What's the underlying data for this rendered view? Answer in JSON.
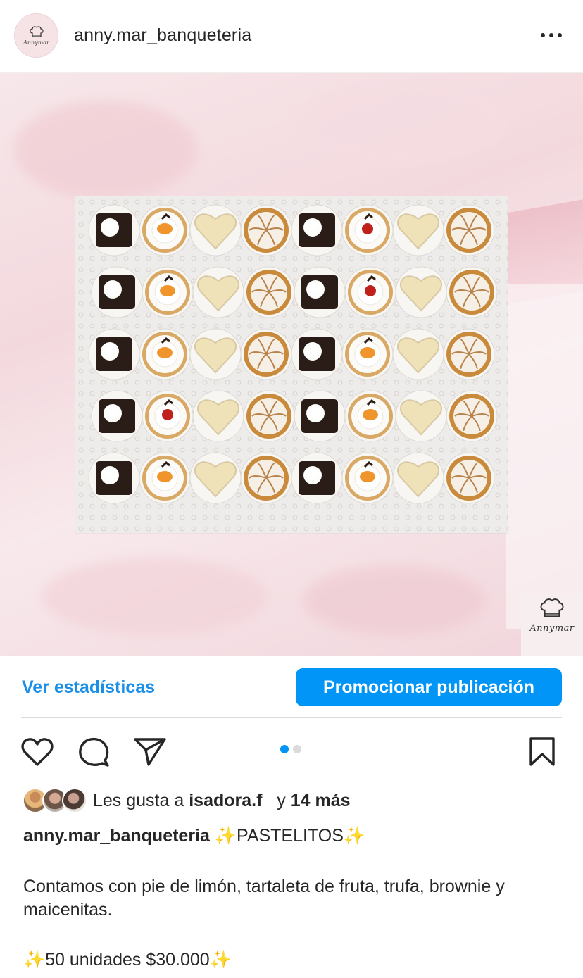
{
  "header": {
    "username": "anny.mar_banqueteria",
    "avatar_icon": "chef-hat-icon",
    "more_icon": "more-options-icon"
  },
  "post": {
    "watermark_icon": "chef-hat-icon",
    "slide_count": 2,
    "active_slide": 1
  },
  "actions": {
    "insights_label": "Ver estadísticas",
    "promote_label": "Promocionar publicación",
    "like_icon": "heart-icon",
    "comment_icon": "comment-icon",
    "share_icon": "paper-plane-icon",
    "save_icon": "bookmark-icon"
  },
  "likes": {
    "prefix": "Les gusta a ",
    "user": "isadora.f_",
    "connector": " y ",
    "others": "14 más"
  },
  "caption": {
    "username": "anny.mar_banqueteria",
    "title_spark_left": "✨",
    "title": "PASTELITOS",
    "title_spark_right": "✨",
    "body": "Contamos con pie de limón, tartaleta de fruta, trufa, brownie y maicenitas.",
    "offer_spark_left": "✨",
    "offer": "50 unidades $30.000",
    "offer_spark_right": "✨"
  },
  "colors": {
    "accent": "#0095f6",
    "link": "#1a8fe8",
    "text": "#262626"
  }
}
